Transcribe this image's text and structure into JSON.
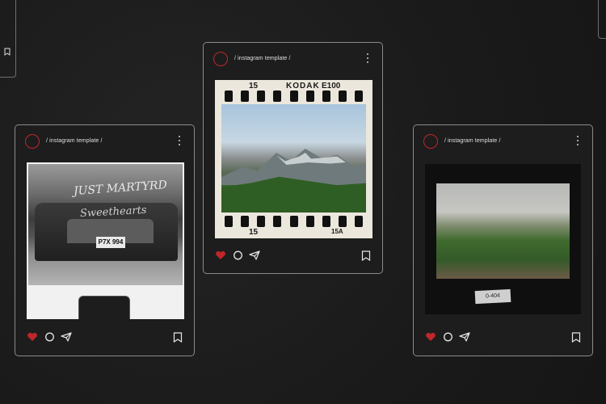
{
  "cards": [
    {
      "handle": "/ instagram template /",
      "photo_text_1": "JUST MARTYRD",
      "photo_text_2": "Sweethearts",
      "plate": "P7X 994"
    },
    {
      "handle": "/ instagram template /",
      "film_top_left": "15",
      "film_brand": "KODAK",
      "film_stock": "E100",
      "film_bottom_left": "15",
      "film_bottom_right": "15A"
    },
    {
      "handle": "/ instagram template /",
      "slide_label": "0-404"
    }
  ],
  "icons": {
    "like": "heart-icon",
    "comment": "comment-icon",
    "share": "send-icon",
    "save": "bookmark-icon",
    "more": "more-vertical-icon"
  },
  "colors": {
    "background": "#1c1c1c",
    "accent": "#c0262a",
    "border": "#8a8a8a"
  }
}
